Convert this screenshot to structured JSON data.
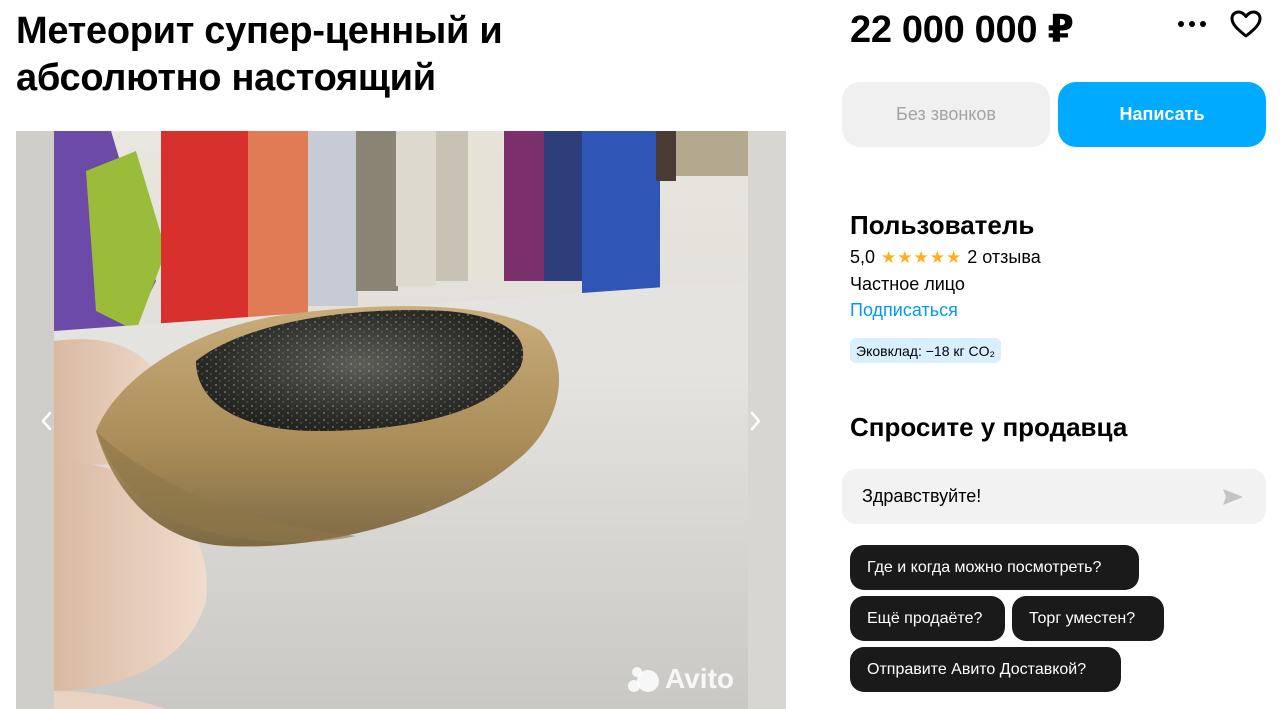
{
  "listing": {
    "title": "Метеорит супер-ценный и абсолютно настоящий",
    "price": "22 000 000 ₽",
    "watermark": "Avito"
  },
  "actions": {
    "no_calls_label": "Без звонков",
    "write_label": "Написать"
  },
  "seller": {
    "name": "Пользователь",
    "rating": "5,0",
    "stars": 5,
    "reviews": "2 отзыва",
    "type": "Частное лицо",
    "subscribe_label": "Подписаться",
    "eco_badge": "Эковклад: −18 кг CO₂"
  },
  "ask": {
    "title": "Спросите у продавца",
    "message_value": "Здравствуйте!",
    "quick_questions": [
      "Где и когда можно посмотреть?",
      "Ещё продаёте?",
      "Торг уместен?",
      "Отправите Авито Доставкой?"
    ]
  },
  "colors": {
    "accent": "#00aaff",
    "link": "#0099f7",
    "star": "#ffb021",
    "chip_bg": "#1a1a1a",
    "eco_bg": "#d7efff"
  }
}
